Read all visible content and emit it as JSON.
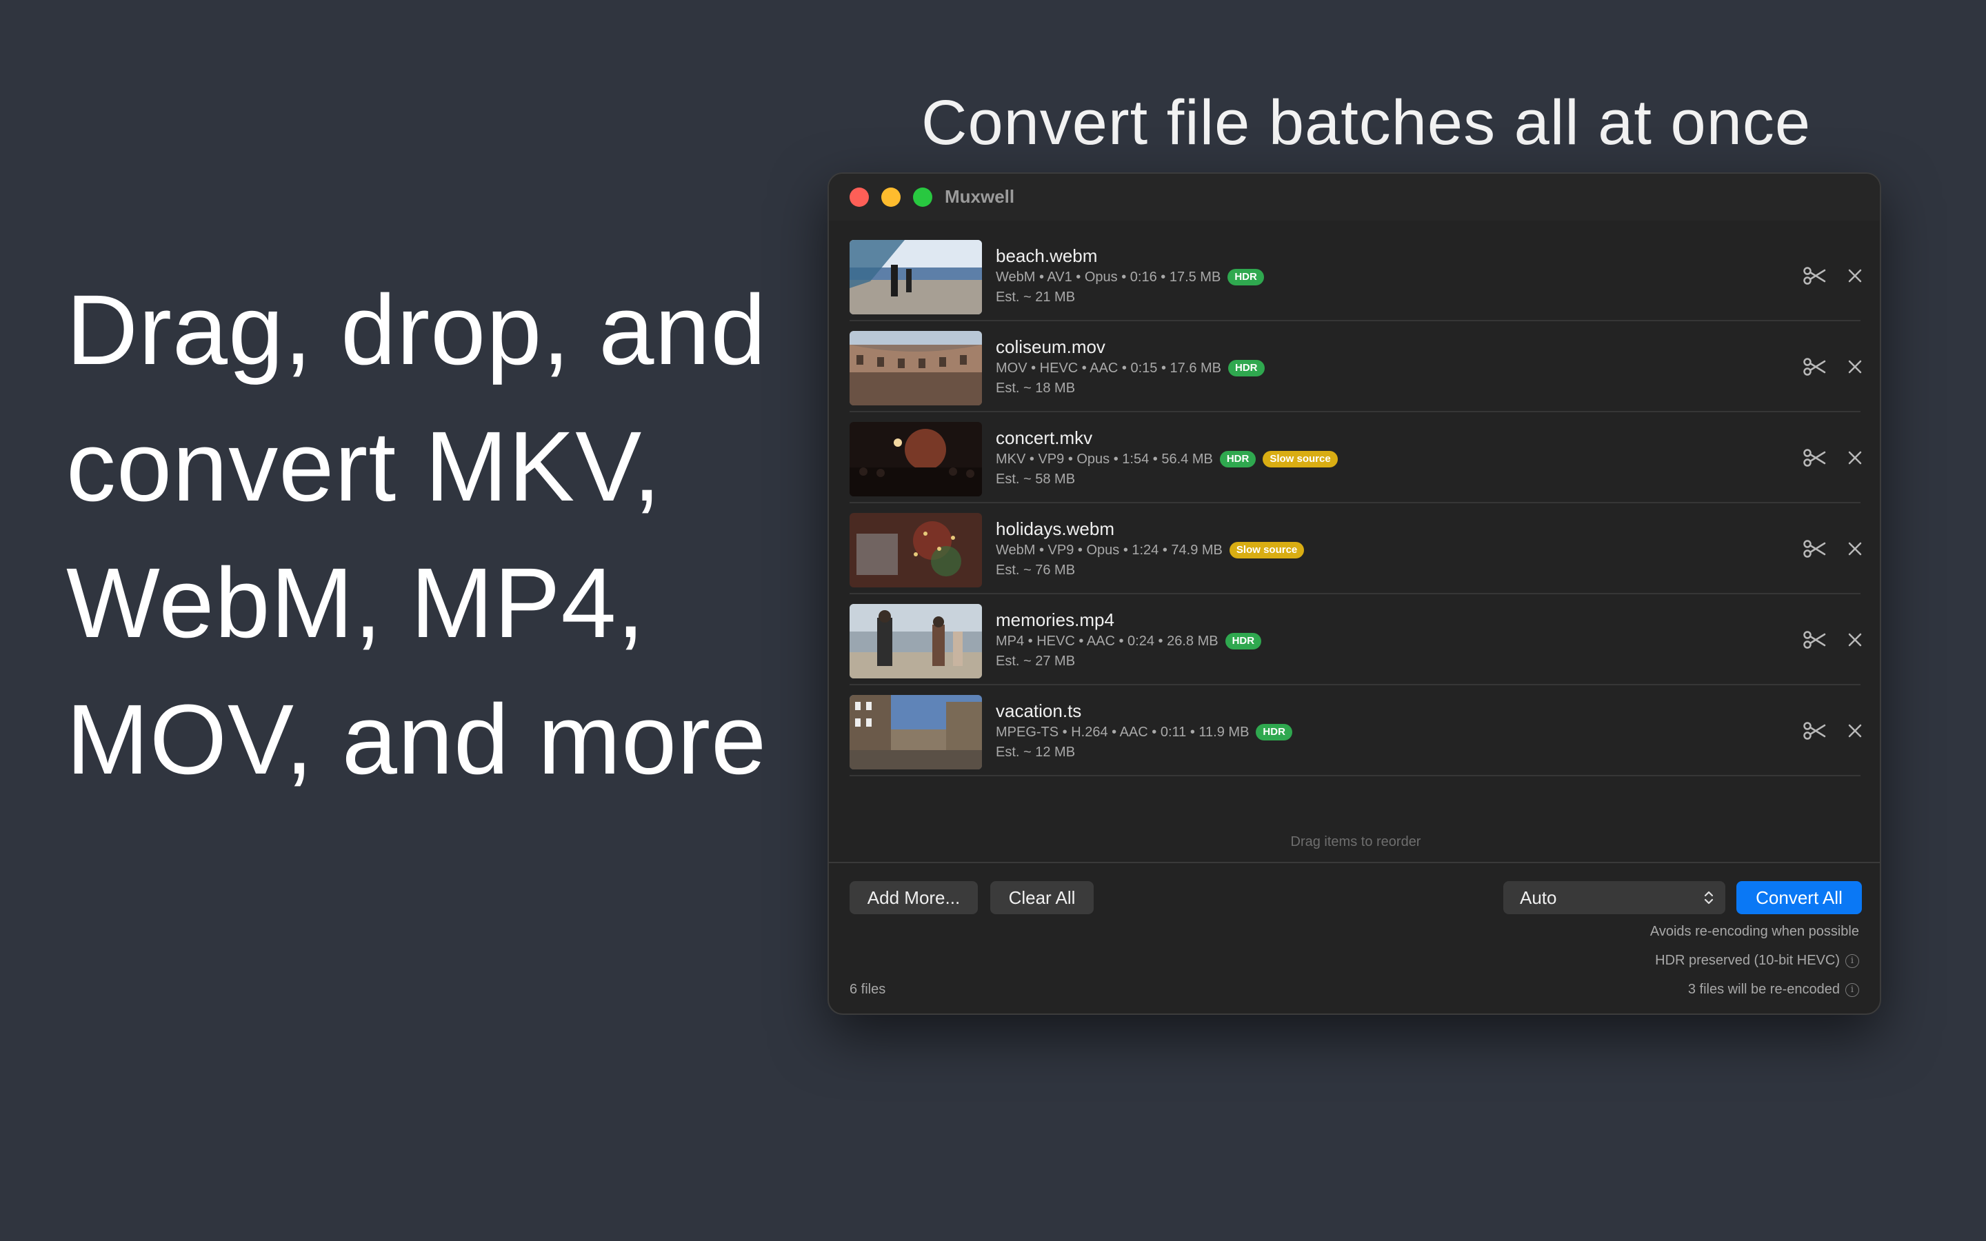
{
  "headline": "Convert file batches all at once",
  "tagline": "Drag, drop, and convert MKV, WebM, MP4, MOV, and more",
  "window": {
    "title": "Muxwell"
  },
  "files": [
    {
      "name": "beach.webm",
      "meta": "WebM • AV1 • Opus • 0:16 • 17.5 MB",
      "badges": [
        "HDR"
      ],
      "estimate": "Est. ~ 21 MB"
    },
    {
      "name": "coliseum.mov",
      "meta": "MOV • HEVC • AAC • 0:15 • 17.6 MB",
      "badges": [
        "HDR"
      ],
      "estimate": "Est. ~ 18 MB"
    },
    {
      "name": "concert.mkv",
      "meta": "MKV • VP9 • Opus • 1:54 • 56.4 MB",
      "badges": [
        "HDR",
        "Slow source"
      ],
      "estimate": "Est. ~ 58 MB"
    },
    {
      "name": "holidays.webm",
      "meta": "WebM • VP9 • Opus • 1:24 • 74.9 MB",
      "badges": [
        "Slow source"
      ],
      "estimate": "Est. ~ 76 MB"
    },
    {
      "name": "memories.mp4",
      "meta": "MP4 • HEVC • AAC • 0:24 • 26.8 MB",
      "badges": [
        "HDR"
      ],
      "estimate": "Est. ~ 27 MB"
    },
    {
      "name": "vacation.ts",
      "meta": "MPEG-TS • H.264 • AAC • 0:11 • 11.9 MB",
      "badges": [
        "HDR"
      ],
      "estimate": "Est. ~ 12 MB"
    }
  ],
  "icons": {
    "trim": "scissors-icon",
    "remove": "close-icon",
    "info": "info-icon",
    "select": "up-down-chevron-icon"
  },
  "colors": {
    "background": "#30353f",
    "window": "#232323",
    "accent": "#0a78f5",
    "hdr_badge": "#2fa84f",
    "slow_badge": "#d9ad13"
  },
  "reorder_hint": "Drag items to reorder",
  "footer": {
    "add_more_label": "Add More...",
    "clear_all_label": "Clear All",
    "format_select_value": "Auto",
    "convert_all_label": "Convert All",
    "notes": [
      "Avoids re-encoding when possible",
      "HDR preserved (10-bit HEVC)",
      "3 files will be re-encoded"
    ],
    "file_count": "6 files"
  }
}
